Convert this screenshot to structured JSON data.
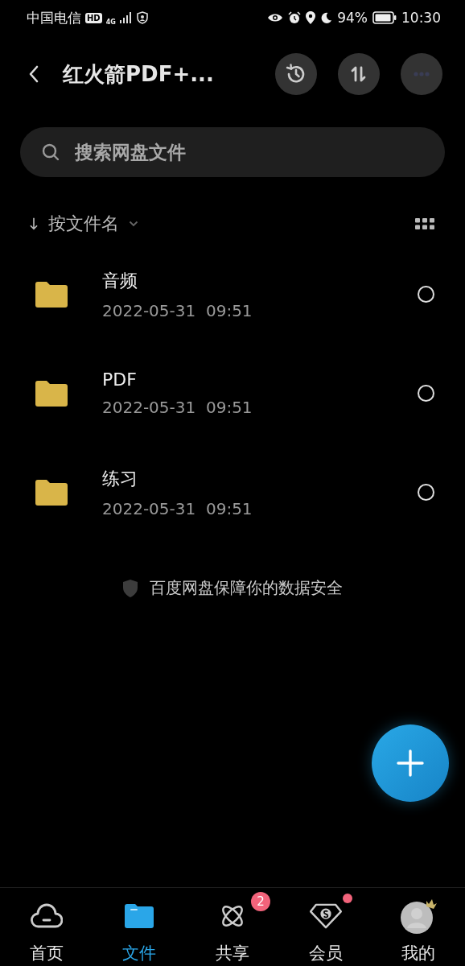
{
  "status_bar": {
    "carrier": "中国电信",
    "hd": "HD",
    "network": "4G",
    "battery": "94%",
    "time": "10:30"
  },
  "header": {
    "title": "红火箭PDF+..."
  },
  "search": {
    "placeholder": "搜索网盘文件"
  },
  "sort": {
    "label": "按文件名"
  },
  "files": [
    {
      "name": "音频",
      "date": "2022-05-31  09:51",
      "selected": false
    },
    {
      "name": "PDF",
      "date": "2022-05-31  09:51",
      "selected": false
    },
    {
      "name": "练习",
      "date": "2022-05-31  09:51",
      "selected": false
    }
  ],
  "notice": "百度网盘保障你的数据安全",
  "bottom_nav": [
    {
      "label": "首页",
      "selected": false
    },
    {
      "label": "文件",
      "selected": true
    },
    {
      "label": "共享",
      "selected": false,
      "badge": "2"
    },
    {
      "label": "会员",
      "selected": false,
      "dot": true
    },
    {
      "label": "我的",
      "selected": false
    }
  ]
}
